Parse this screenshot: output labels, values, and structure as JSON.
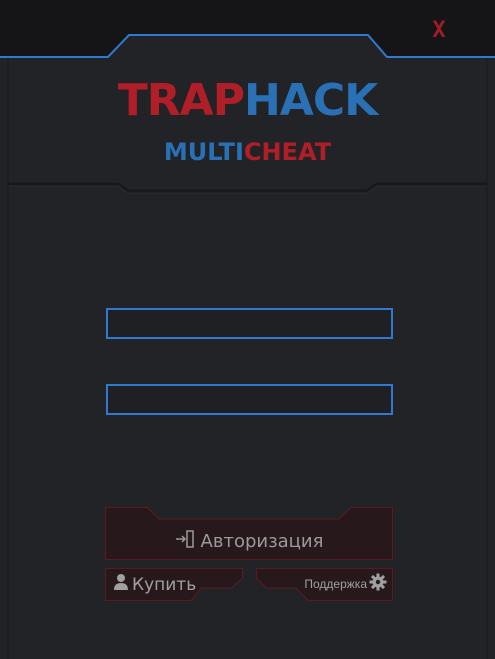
{
  "window": {
    "close_label": "X"
  },
  "logo": {
    "part_red": "TRAP",
    "part_blue": "HACK",
    "sub_blue": "MULTI",
    "sub_red": "CHEAT"
  },
  "form": {
    "login_value": "",
    "password_value": ""
  },
  "buttons": {
    "auth_label": "Авторизация",
    "buy_label": "Купить",
    "support_label": "Поддержка"
  },
  "icons": {
    "auth": "login-icon",
    "buy": "user-icon",
    "support": "gear-icon",
    "close": "close-icon"
  },
  "colors": {
    "background": "#1f2024",
    "accent_blue": "#2f7ad0",
    "accent_red": "#b01e28",
    "button_border": "#5a1c22",
    "text_gray": "#9a9a9a"
  }
}
